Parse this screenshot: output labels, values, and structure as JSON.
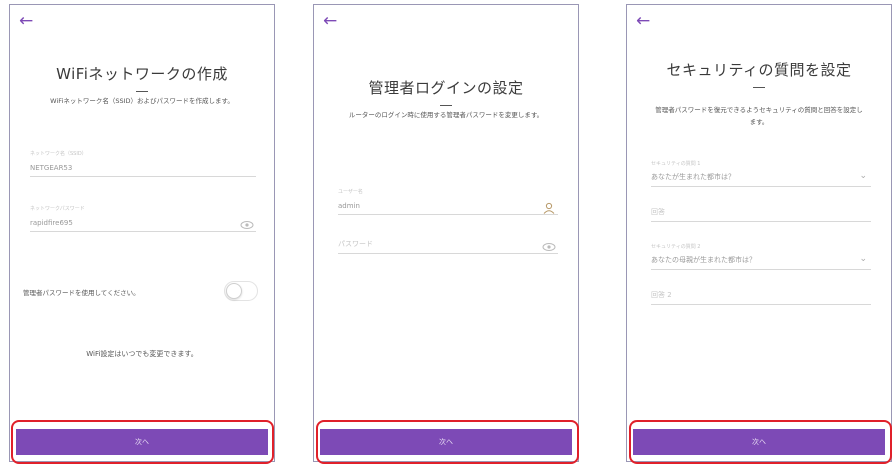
{
  "screens": [
    {
      "back_icon": "←",
      "title": "WiFiネットワークの作成",
      "description": "WiFiネットワーク名（SSID）およびパスワードを作成します。",
      "fields": [
        {
          "label": "ネットワーク名（SSID）",
          "value": "NETGEAR53"
        },
        {
          "label": "ネットワークパスワード",
          "value": "rapidfire695",
          "icon": "eye-icon"
        }
      ],
      "toggle_label": "管理者パスワードを使用してください。",
      "toggle_on": false,
      "note": "WiFi設定はいつでも変更できます。",
      "next_label": "次へ"
    },
    {
      "back_icon": "←",
      "title": "管理者ログインの設定",
      "description": "ルーターのログイン時に使用する管理者パスワードを変更します。",
      "fields": [
        {
          "label": "ユーザー名",
          "value": "admin",
          "icon": "user-icon"
        },
        {
          "placeholder": "パスワード",
          "icon": "eye-icon"
        }
      ],
      "next_label": "次へ"
    },
    {
      "back_icon": "←",
      "title": "セキュリティの質問を設定",
      "description": "管理者パスワードを復元できるようセキュリティの質問と回答を設定します。",
      "fields": [
        {
          "label": "セキュリティの質問 1",
          "value": "あなたが生まれた都市は？",
          "icon": "chevron-down-icon"
        },
        {
          "placeholder": "回答"
        },
        {
          "label": "セキュリティの質問 2",
          "value": "あなたの母親が生まれた都市は？",
          "icon": "chevron-down-icon"
        },
        {
          "placeholder": "回答 2"
        }
      ],
      "next_label": "次へ"
    }
  ],
  "colors": {
    "accent": "#7d4ab6",
    "highlight": "#e0202a",
    "frame": "#9a97b5"
  }
}
